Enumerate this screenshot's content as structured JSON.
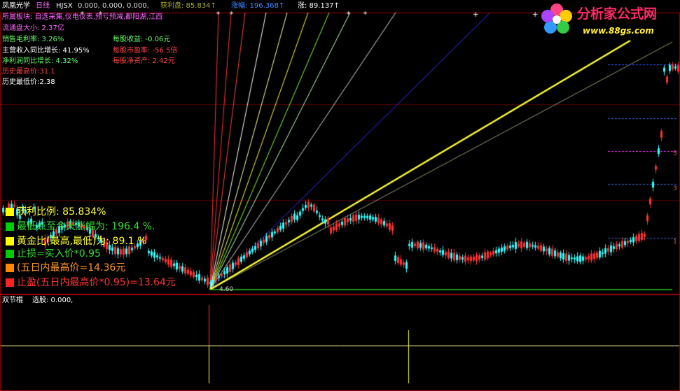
{
  "header": {
    "name": "凤凰光学",
    "period": "日线",
    "indicator": "HJSX",
    "values": "0.000, 0.000, 0.000,",
    "profit_label": "获利盘: 85.834↑",
    "range_label": "涨幅: 196.368↑",
    "rise_label": "涨: 89.137↑"
  },
  "info": {
    "sector": "所属板块: 自选采集,仪电仪表,预亏预减,鄱阳湖,江西",
    "float_cap": "流通盘大小: 2.37亿",
    "gross_margin": "销售毛利率: 3.26%",
    "eps": "每股收益: -0.06元",
    "revenue_growth": "主营收入同比增长: 41.95%",
    "pe": "每股市盈率: -56.5倍",
    "profit_growth": "净利润同比增长: 4.32%",
    "nav": "每股净资产: 2.42元",
    "hist_high": "历史最高价:31.1",
    "hist_low": "历史最低价:2.38"
  },
  "legend": [
    {
      "text": "获利比例: 85.834%",
      "color": "#ffff33",
      "box": "#ffff00"
    },
    {
      "text": "最低点至今天涨幅为: 196.4 %.",
      "color": "#33dd33",
      "box": "#00cc00"
    },
    {
      "text": "黄金比(最高,最低)为: 89.1 %",
      "color": "#ffff33",
      "box": "#ffff00"
    },
    {
      "text": "止损=买入价*0.95",
      "color": "#33dd33",
      "box": "#00cc00"
    },
    {
      "text": "(五日内最高价=14.36元",
      "color": "#ff9922",
      "box": "#ff8800"
    },
    {
      "text": "止盈(五日内最高价*0.95)=13.64元",
      "color": "#ff3333",
      "box": "#ff2222"
    }
  ],
  "low_marker": "4.60",
  "right_axis": [
    "5",
    "3",
    "1"
  ],
  "sub_panel": {
    "name": "双节棍",
    "value": "选股: 0.000,"
  },
  "logo": {
    "title": "分析家公式网",
    "url": "www.88gs.com"
  },
  "colors": {
    "background": "#000000",
    "frame": "#a00000",
    "rise": "#ff3333",
    "fall": "#33ffff",
    "gann_line": "#ffff33"
  }
}
